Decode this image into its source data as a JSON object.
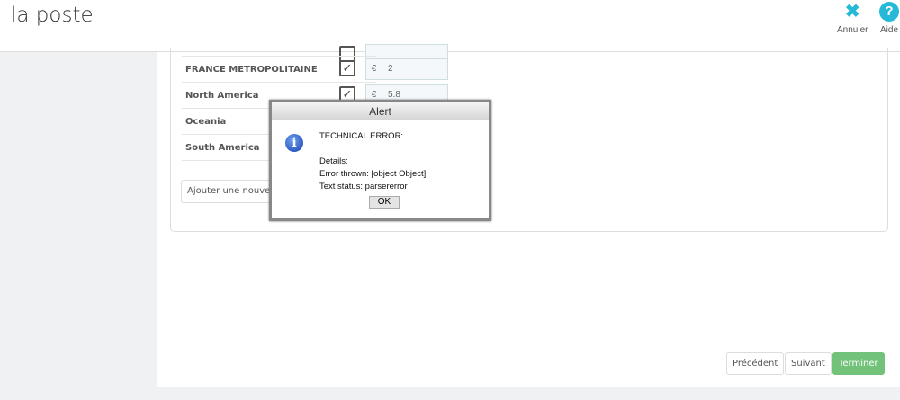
{
  "header": {
    "title": "la poste",
    "cancel": "Annuler",
    "help": "Aide",
    "cancel_icon": "✖",
    "help_icon": "?"
  },
  "zones": [
    {
      "name": "",
      "checked": true,
      "currency": "€",
      "price": ""
    },
    {
      "name": "FRANCE METROPOLITAINE",
      "checked": true,
      "currency": "€",
      "price": "2"
    },
    {
      "name": "North America",
      "checked": true,
      "currency": "€",
      "price": "5.8"
    },
    {
      "name": "Oceania"
    },
    {
      "name": "South America"
    }
  ],
  "add_range": "Ajouter une nouvelle",
  "footer": {
    "prev": "Précédent",
    "next": "Suivant",
    "finish": "Terminer",
    "finish_color": "#72c279"
  },
  "alert": {
    "title": "Alert",
    "line1": "TECHNICAL ERROR:",
    "line2": "Details:",
    "line3": "Error thrown: [object Object]",
    "line4": "Text status: parsererror",
    "ok": "OK"
  }
}
